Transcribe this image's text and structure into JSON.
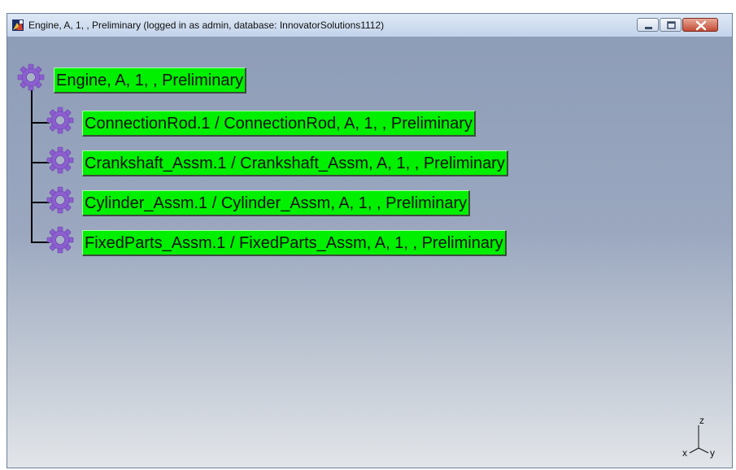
{
  "window": {
    "title": "Engine, A, 1, , Preliminary (logged in as admin, database: InnovatorSolutions1112)"
  },
  "tree": {
    "root": {
      "label": "Engine, A, 1, , Preliminary",
      "icon": "gear-icon"
    },
    "children": [
      {
        "label": "ConnectionRod.1 / ConnectionRod, A, 1, , Preliminary",
        "icon": "gear-icon"
      },
      {
        "label": "Crankshaft_Assm.1 / Crankshaft_Assm, A, 1, , Preliminary",
        "icon": "gear-icon"
      },
      {
        "label": "Cylinder_Assm.1 / Cylinder_Assm, A, 1, , Preliminary",
        "icon": "gear-icon"
      },
      {
        "label": "FixedParts_Assm.1 / FixedParts_Assm, A, 1, , Preliminary",
        "icon": "gear-icon"
      }
    ],
    "node_color": "#00f000",
    "gear_color": "#8c5fcf"
  },
  "axis": {
    "z": "z",
    "x": "x",
    "y": "y"
  }
}
